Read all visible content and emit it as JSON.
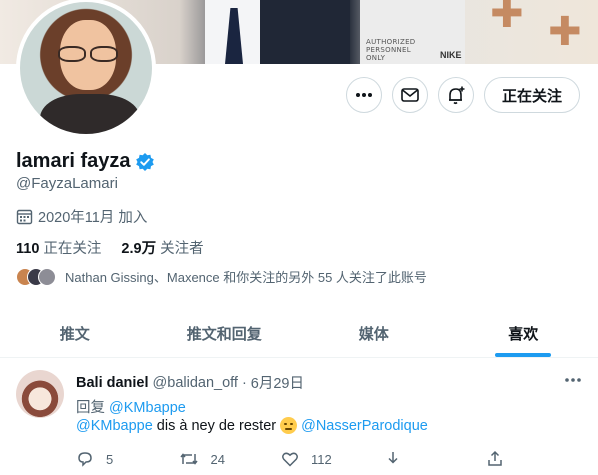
{
  "banner": {
    "hoodie_text": "AUTHORIZED\nPERSONNEL\nONLY",
    "brand_text": "NIKE"
  },
  "profile": {
    "name": "lamari fayza",
    "handle": "@FayzaLamari",
    "verified": true,
    "joined": "2020年11月 加入",
    "following_count": "110",
    "following_label": "正在关注",
    "followers_count": "2.9万",
    "followers_label": "关注者",
    "mutual_text": "Nathan Gissing、Maxence 和你关注的另外 55 人关注了此账号"
  },
  "actions": {
    "more_icon": "more-icon",
    "message_icon": "envelope-icon",
    "notify_icon": "bell-plus-icon",
    "follow_label": "正在关注"
  },
  "tabs": [
    {
      "label": "推文"
    },
    {
      "label": "推文和回复"
    },
    {
      "label": "媒体"
    },
    {
      "label": "喜欢",
      "active": true
    }
  ],
  "tweet": {
    "author_name": "Bali daniel",
    "author_handle": "@balidan_off",
    "separator": "·",
    "date": "6月29日",
    "reply_prefix": "回复",
    "reply_to": "@KMbappe",
    "mention_1": "@KMbappe",
    "body": "dis à ney de rester",
    "mention_2": "@NasserParodique",
    "replies": "5",
    "retweets": "24",
    "likes": "112"
  },
  "colors": {
    "accent": "#1d9bf0",
    "text_primary": "#0f1419",
    "text_secondary": "#536471",
    "border": "#cfd9de"
  }
}
